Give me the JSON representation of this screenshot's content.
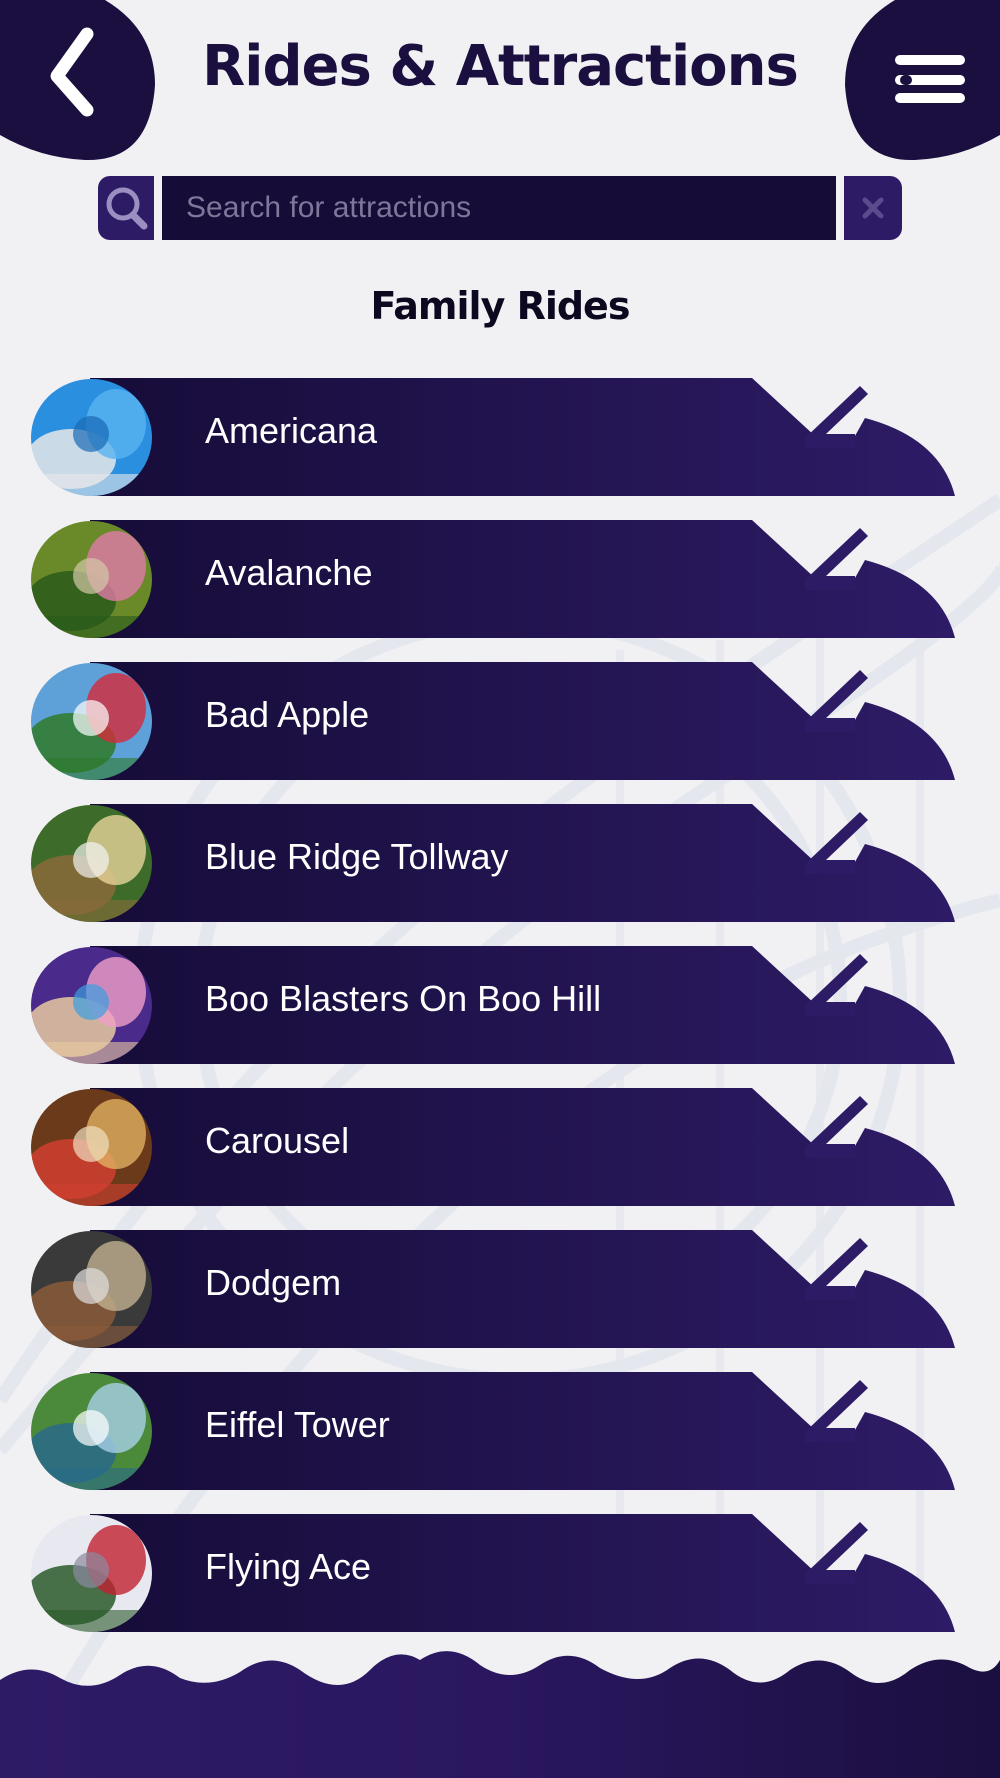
{
  "header": {
    "title": "Rides & Attractions",
    "back_icon": "chevron-left-icon",
    "menu_icon": "hamburger-menu-icon"
  },
  "search": {
    "placeholder": "Search for attractions",
    "value": "",
    "search_icon": "search-icon",
    "clear_icon": "close-icon"
  },
  "section": {
    "title": "Family Rides"
  },
  "rides": [
    {
      "label": "Americana",
      "thumb": "ferris-wheel-photo"
    },
    {
      "label": "Avalanche",
      "thumb": "kids-on-coaster-photo"
    },
    {
      "label": "Bad Apple",
      "thumb": "red-swing-ride-photo"
    },
    {
      "label": "Blue Ridge Tollway",
      "thumb": "antique-cars-photo"
    },
    {
      "label": "Boo Blasters On Boo Hill",
      "thumb": "kids-with-blasters-photo"
    },
    {
      "label": "Carousel",
      "thumb": "carousel-photo"
    },
    {
      "label": "Dodgem",
      "thumb": "bumper-cars-photo"
    },
    {
      "label": "Eiffel Tower",
      "thumb": "eiffel-tower-photo"
    },
    {
      "label": "Flying Ace",
      "thumb": "flying-ace-photo"
    }
  ],
  "colors": {
    "primary": "#1b0f3f",
    "banner_light": "#2e1b66",
    "background": "#f1f1f3",
    "search_field": "#160c38"
  }
}
